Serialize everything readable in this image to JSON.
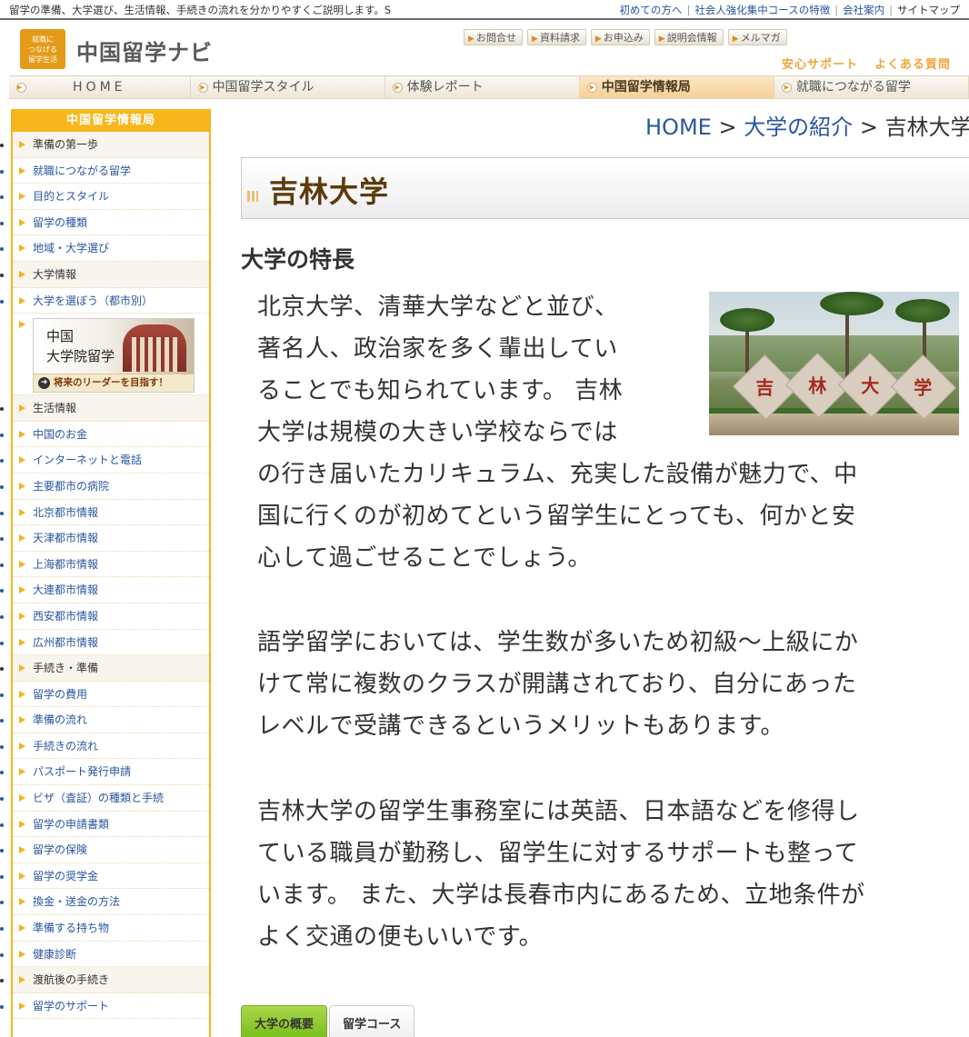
{
  "topbar": {
    "tagline": "留学の準備、大学選び、生活情報、手続きの流れを分かりやすくご説明します。S",
    "links": [
      "初めての方へ",
      "社会人強化集中コースの特徴",
      "会社案内",
      "サイトマップ"
    ]
  },
  "header": {
    "logo_mark": "就職に\nつなげる\n留学生活",
    "logo_text": "中国留学ナビ",
    "utility_buttons": [
      "お問合せ",
      "資料請求",
      "お申込み",
      "説明会情報",
      "メルマガ"
    ],
    "support_links": [
      "安心サポート",
      "よくある質問"
    ]
  },
  "nav": {
    "tabs": [
      "HOME",
      "中国留学スタイル",
      "体験レポート",
      "中国留学情報局",
      "就職につながる留学"
    ],
    "active": "中国留学情報局"
  },
  "sidebar": {
    "title": "中国留学情報局",
    "items_a": [
      {
        "label": "準備の第一歩",
        "section": true
      },
      {
        "label": "就職につながる留学",
        "section": false
      },
      {
        "label": "目的とスタイル",
        "section": false
      },
      {
        "label": "留学の種類",
        "section": false
      },
      {
        "label": "地域・大学選び",
        "section": false
      },
      {
        "label": "大学情報",
        "section": true
      },
      {
        "label": "大学を選ぼう（都市別）",
        "section": false
      }
    ],
    "banner": {
      "line1": "中国",
      "line2": "大学院留学",
      "footer": "将来のリーダーを目指す！"
    },
    "items_b": [
      {
        "label": "生活情報",
        "section": true
      },
      {
        "label": "中国のお金",
        "section": false
      },
      {
        "label": "インターネットと電話",
        "section": false
      },
      {
        "label": "主要都市の病院",
        "section": false
      },
      {
        "label": "北京都市情報",
        "section": false
      },
      {
        "label": "天津都市情報",
        "section": false
      },
      {
        "label": "上海都市情報",
        "section": false
      },
      {
        "label": "大連都市情報",
        "section": false
      },
      {
        "label": "西安都市情報",
        "section": false
      },
      {
        "label": "広州都市情報",
        "section": false
      },
      {
        "label": "手続き・準備",
        "section": true
      },
      {
        "label": "留学の費用",
        "section": false
      },
      {
        "label": "準備の流れ",
        "section": false
      },
      {
        "label": "手続きの流れ",
        "section": false
      },
      {
        "label": "パスポート発行申請",
        "section": false
      },
      {
        "label": "ビザ（査証）の種類と手続",
        "section": false
      },
      {
        "label": "留学の申請書類",
        "section": false
      },
      {
        "label": "留学の保険",
        "section": false
      },
      {
        "label": "留学の奨学金",
        "section": false
      },
      {
        "label": "換金・送金の方法",
        "section": false
      },
      {
        "label": "準備する持ち物",
        "section": false
      },
      {
        "label": "健康診断",
        "section": false
      },
      {
        "label": "渡航後の手続き",
        "section": true
      },
      {
        "label": "留学のサポート",
        "section": false
      }
    ]
  },
  "breadcrumb": {
    "home": "HOME",
    "sep": " > ",
    "parent": "大学の紹介",
    "current": "吉林大学"
  },
  "main": {
    "title": "吉林大学",
    "section_heading": "大学の特長",
    "photo_characters": [
      "吉",
      "林",
      "大",
      "学"
    ],
    "para1_a": "北京大学、清華大学などと並び、\n著名人、政治家を多く輩出してい\nることでも知られています。 吉林\n大学は規模の大きい学校ならでは",
    "para1_b": "の行き届いたカリキュラム、充実した設備が魅力で、中\n国に行くのが初めてという留学生にとっても、何かと安\n心して過ごせることでしょう。",
    "para2": "語学留学においては、学生数が多いため初級～上級にか\nけて常に複数のクラスが開講されており、自分にあった\nレベルで受講できるというメリットもあります。",
    "para3": "吉林大学の留学生事務室には英語、日本語などを修得し\nている職員が勤務し、留学生に対するサポートも整って\nいます。 また、大学は長春市内にあるため、立地条件が\nよく交通の便もいいです。",
    "tabs": [
      "大学の概要",
      "留学コース"
    ],
    "active_tab": "大学の概要"
  }
}
